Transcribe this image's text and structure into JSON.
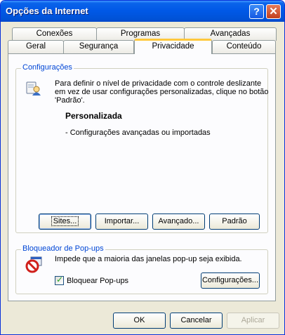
{
  "window": {
    "title": "Opções da Internet",
    "help_label": "?",
    "close_label": "✕"
  },
  "tabs": {
    "row_back": [
      "Conexões",
      "Programas",
      "Avançadas"
    ],
    "row_front": [
      "Geral",
      "Segurança",
      "Privacidade",
      "Conteúdo"
    ],
    "active": "Privacidade"
  },
  "settings": {
    "group_label": "Configurações",
    "description_line1": "Para definir o nível de privacidade com o controle deslizante",
    "description_line2": "em vez de usar configurações personalizadas, clique no botão",
    "description_line3": "'Padrão'.",
    "level_title": "Personalizada",
    "level_detail": "- Configurações avançadas ou importadas",
    "buttons": {
      "sites": "Sites...",
      "import": "Importar...",
      "advanced": "Avançado...",
      "default": "Padrão"
    }
  },
  "popup": {
    "group_label": "Bloqueador de Pop-ups",
    "description": "Impede que a maioria das janelas pop-up seja exibida.",
    "checkbox_label": "Bloquear Pop-ups",
    "checkbox_checked": true,
    "settings_button": "Configurações..."
  },
  "footer": {
    "ok": "OK",
    "cancel": "Cancelar",
    "apply": "Aplicar"
  }
}
